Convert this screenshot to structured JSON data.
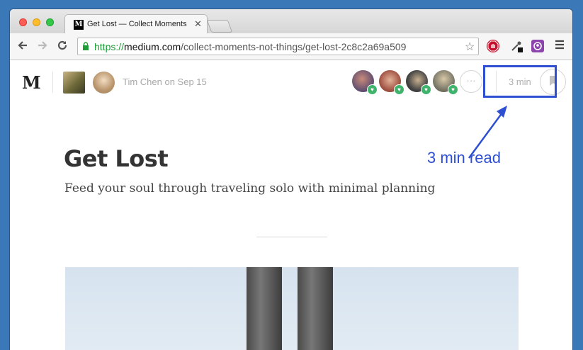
{
  "browser": {
    "tab": {
      "favicon": "M",
      "title": "Get Lost — Collect Moments Not Things"
    },
    "url": {
      "scheme": "https://",
      "host": "medium.com",
      "path": "/collect-moments-not-things/get-lost-2c8c2a69a509"
    }
  },
  "header": {
    "logo": "M",
    "byline": "Tim Chen on Sep 15",
    "read_time": "3 min",
    "more_label": "···"
  },
  "annotation": {
    "label": "3 min read",
    "color": "#2e4fd1"
  },
  "article": {
    "title": "Get Lost",
    "subtitle": "Feed your soul through traveling solo with minimal planning"
  },
  "colors": {
    "accent_green": "#3fb36b",
    "https_green": "#1e9d37"
  }
}
